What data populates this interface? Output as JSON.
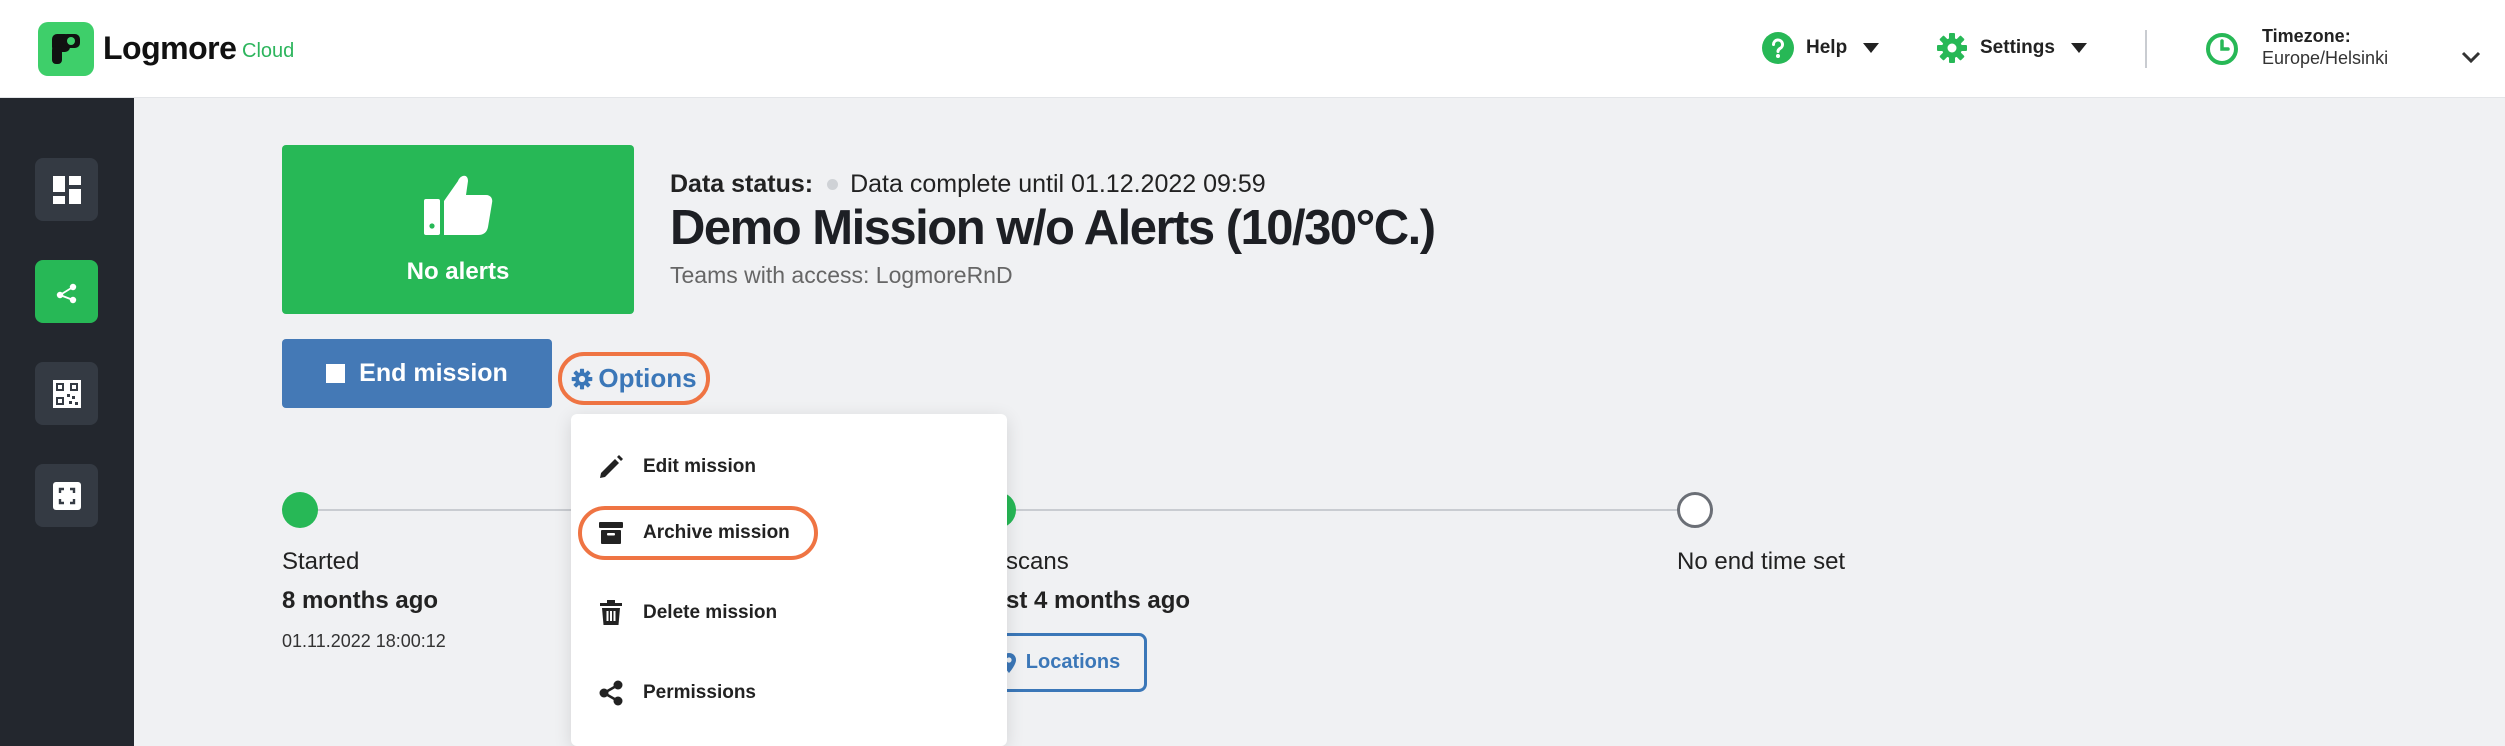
{
  "header": {
    "brand": "Logmore",
    "brand_sub": "Cloud",
    "help_label": "Help",
    "settings_label": "Settings",
    "timezone_label": "Timezone:",
    "timezone_value": "Europe/Helsinki"
  },
  "sidebar": {
    "items": [
      {
        "name": "dashboard",
        "icon": "dashboard-icon",
        "active": false
      },
      {
        "name": "missions",
        "icon": "share-nodes-icon",
        "active": true
      },
      {
        "name": "qr-codes",
        "icon": "qr-code-icon",
        "active": false
      },
      {
        "name": "scan",
        "icon": "scan-icon",
        "active": false
      }
    ]
  },
  "alert_card": {
    "label": "No alerts",
    "icon": "thumbs-up-icon",
    "color": "#27b856"
  },
  "mission": {
    "data_status_label": "Data status:",
    "data_status_value": "Data complete until 01.12.2022 09:59",
    "title": "Demo Mission w/o Alerts (10/30°C.)",
    "teams": "Teams with access: LogmoreRnD"
  },
  "actions": {
    "end_mission": "End mission",
    "options": "Options"
  },
  "menu": {
    "items": [
      {
        "label": "Edit mission",
        "icon": "pencil-icon"
      },
      {
        "label": "Archive mission",
        "icon": "archive-box-icon",
        "highlighted": true
      },
      {
        "label": "Delete mission",
        "icon": "trash-icon"
      },
      {
        "label": "Permissions",
        "icon": "share-icon"
      }
    ]
  },
  "timeline": {
    "started_label": "Started",
    "started_ago": "8 months ago",
    "started_date": "01.11.2022 18:00:12",
    "scans_label": "scans",
    "scans_ago": "st 4 months ago",
    "locations_button": "Locations",
    "end_label": "No end time set"
  },
  "colors": {
    "accent_green": "#27b856",
    "primary_blue": "#4479b6",
    "highlight_orange": "#ef7443",
    "sidebar_bg": "#23272e"
  }
}
